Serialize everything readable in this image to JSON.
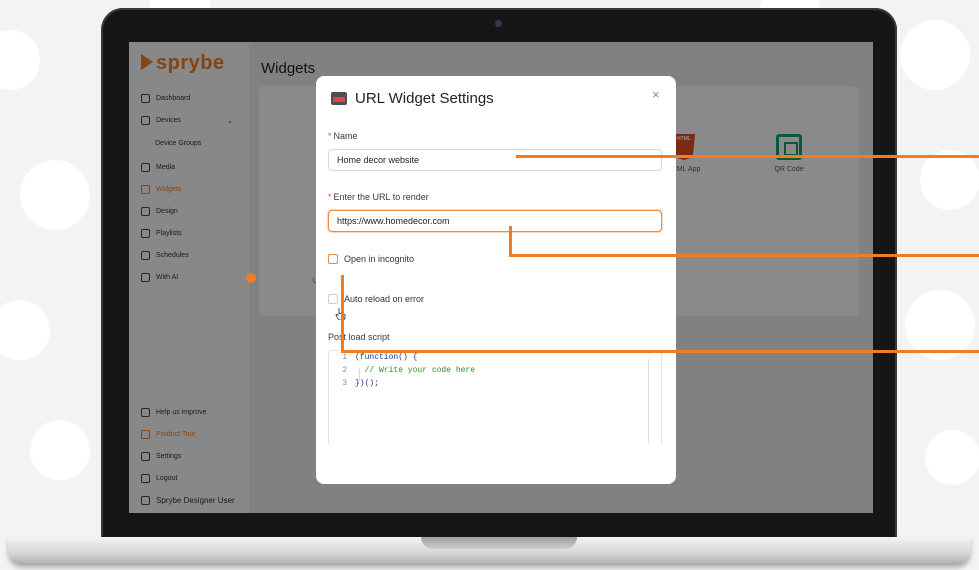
{
  "sidebar": {
    "logo_text": "sprybe",
    "items": [
      {
        "label": "Dashboard",
        "active": false
      },
      {
        "label": "Devices",
        "active": false
      },
      {
        "label": "Device Groups",
        "active": false
      },
      {
        "label": "Media",
        "active": false
      },
      {
        "label": "Widgets",
        "active": true
      },
      {
        "label": "Design",
        "active": false
      },
      {
        "label": "Playlists",
        "active": false
      },
      {
        "label": "Schedules",
        "active": false
      },
      {
        "label": "With AI",
        "active": false
      }
    ],
    "footer_items": [
      {
        "label": "Help us improve"
      },
      {
        "label": "Product Tour"
      },
      {
        "label": "Settings"
      },
      {
        "label": "Logout"
      },
      {
        "label": "Sprybe Designer User"
      }
    ]
  },
  "main": {
    "title": "Widgets",
    "tiles": [
      {
        "label": "HTML App",
        "icon": "html5-icon"
      },
      {
        "label": "QR Code",
        "icon": "qr-code-icon"
      }
    ],
    "partial_tile_label": "Ul"
  },
  "modal": {
    "title": "URL Widget Settings",
    "close_glyph": "×",
    "name": {
      "label": "Name",
      "required": true,
      "value": "Home decor website"
    },
    "url": {
      "label": "Enter the URL to render",
      "required": true,
      "value": "https://www.homedecor.com"
    },
    "incognito": {
      "label": "Open in incognito",
      "checked": false
    },
    "auto_reload": {
      "label": "Auto reload on error",
      "checked": false
    },
    "script": {
      "label": "Post load script",
      "lines": [
        {
          "n": "1",
          "text": "(function() {"
        },
        {
          "n": "2",
          "text": "  // Write your code here"
        },
        {
          "n": "3",
          "text": "})();"
        }
      ]
    }
  },
  "colors": {
    "accent": "#f07c25",
    "required": "#e24b3b",
    "code_keyword": "#1d3a8a",
    "code_comment": "#2e8b2e"
  }
}
